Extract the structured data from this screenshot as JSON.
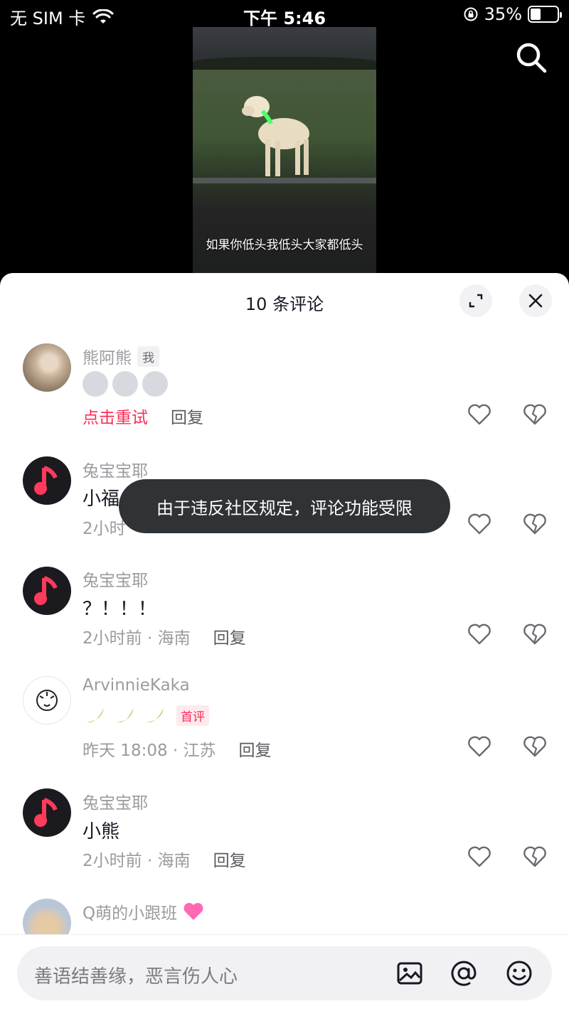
{
  "status_bar": {
    "carrier": "无 SIM 卡",
    "time": "下午 5:46",
    "battery": "35%"
  },
  "video": {
    "caption": "如果你低头我低头大家都低头"
  },
  "sheet": {
    "title": "10 条评论"
  },
  "toast": "由于违反社区规定，评论功能受限",
  "comments": [
    {
      "user": "熊阿熊",
      "tag": "我",
      "text": "",
      "emoji": [
        "husky-emoji",
        "husky-emoji",
        "husky-emoji"
      ],
      "retry": "点击重试",
      "reply": "回复"
    },
    {
      "user": "兔宝宝耶",
      "text": "小福",
      "meta": "2小时",
      "reply": ""
    },
    {
      "user": "兔宝宝耶",
      "text": "？！！！",
      "meta": "2小时前 · 海南",
      "reply": "回复"
    },
    {
      "user": "ArvinnieKaka",
      "text": "",
      "emoji": [
        "banana-emoji",
        "banana-emoji",
        "banana-emoji"
      ],
      "tag": "首评",
      "meta": "昨天 18:08 · 江苏",
      "reply": "回复"
    },
    {
      "user": "兔宝宝耶",
      "text": "小熊",
      "meta": "2小时前 · 海南",
      "reply": "回复"
    },
    {
      "user": "Q萌的小跟班",
      "text": ""
    }
  ],
  "input": {
    "placeholder": "善语结善缘，恶言伤人心"
  }
}
